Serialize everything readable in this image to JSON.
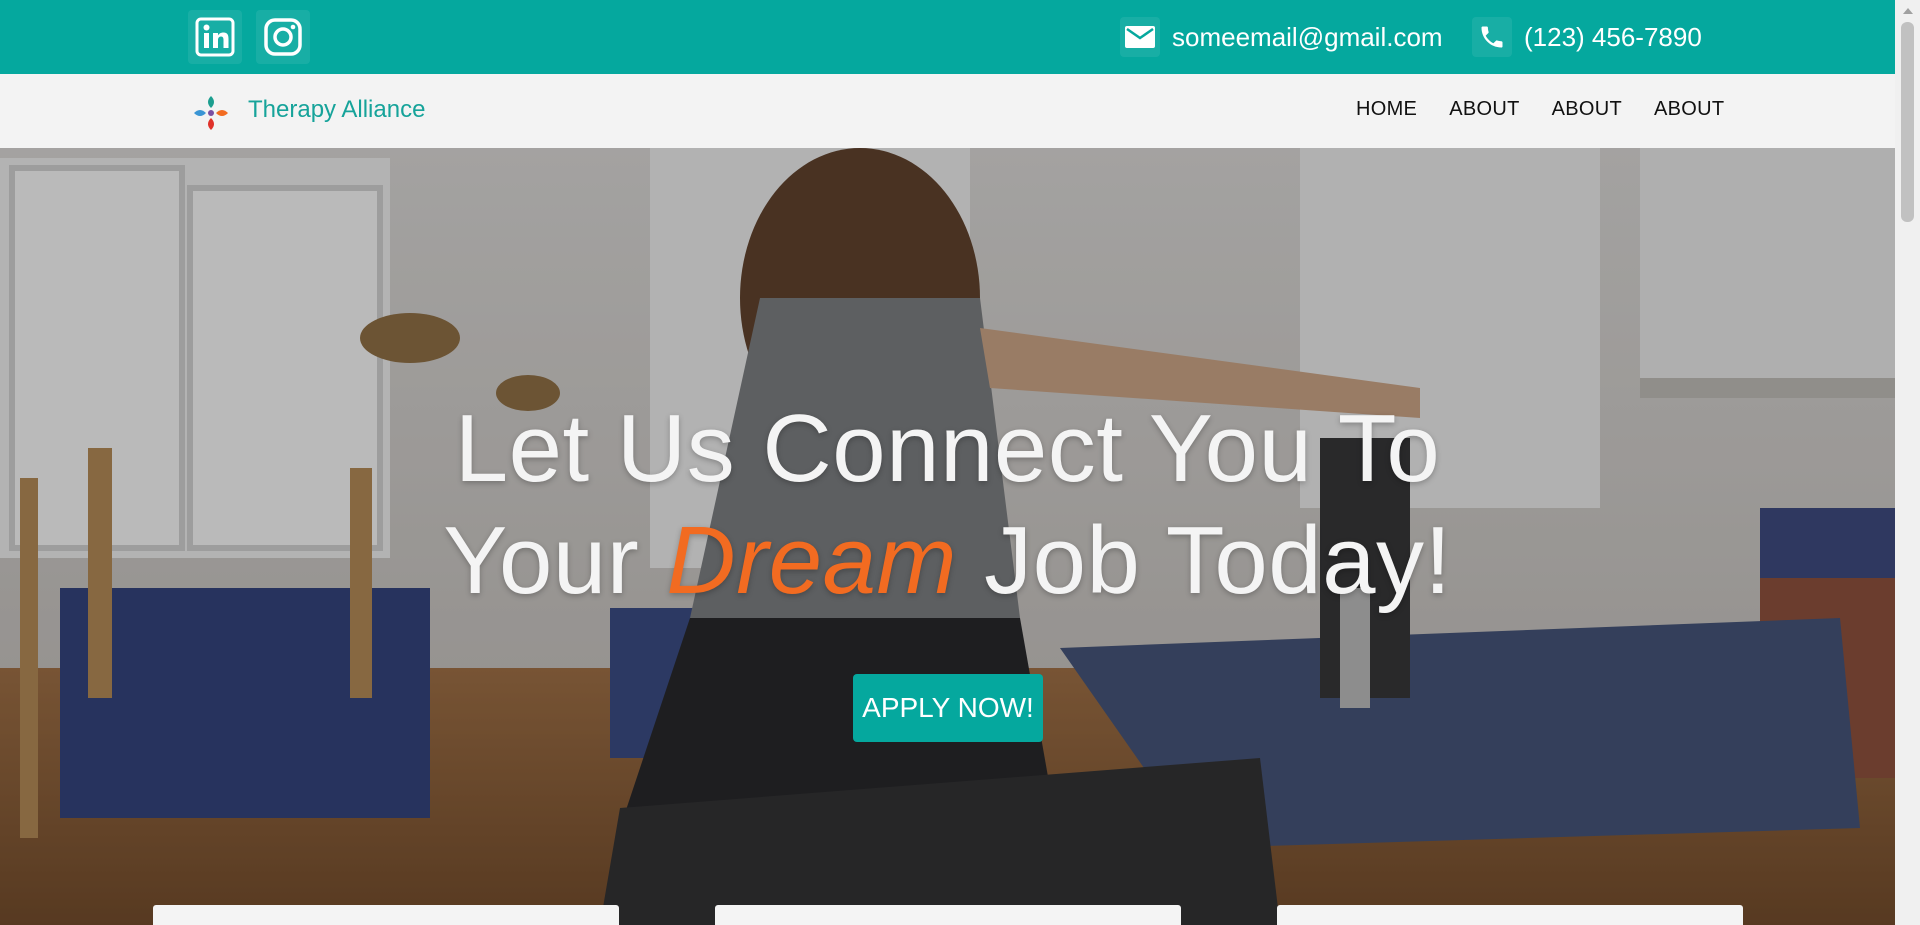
{
  "topbar": {
    "social": [
      {
        "name": "linkedin-icon"
      },
      {
        "name": "instagram-icon"
      }
    ],
    "email": "someemail@gmail.com",
    "phone": "(123) 456-7890",
    "color": "#05a89e"
  },
  "nav": {
    "brand": "Therapy Alliance",
    "links": [
      "HOME",
      "ABOUT",
      "ABOUT",
      "ABOUT"
    ]
  },
  "hero": {
    "line1": "Let Us Connect You To",
    "line2_prefix": "Your",
    "line2_accent": "Dream",
    "line2_suffix": "Job Today!",
    "accent_color": "#f26b21",
    "button_label": "APPLY NOW!"
  }
}
